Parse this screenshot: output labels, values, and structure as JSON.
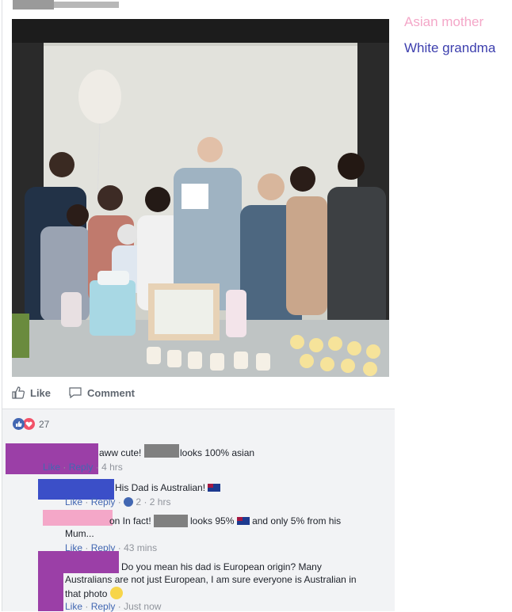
{
  "legend": {
    "asian_mother": "Asian mother",
    "white_grandma": "White grandma",
    "colors": {
      "asian_mother": "#f4a7c8",
      "white_grandma": "#3d3fae"
    }
  },
  "post": {
    "actions": {
      "like": "Like",
      "comment": "Comment"
    },
    "reactions": {
      "count": "27"
    }
  },
  "comments": [
    {
      "text_a": "aww cute!",
      "text_b": "looks 100% asian",
      "like": "Like",
      "reply": "Reply",
      "time": "4 hrs"
    },
    {
      "text": "His Dad is Australian!",
      "like": "Like",
      "reply": "Reply",
      "likes": "2",
      "time": "2 hrs"
    },
    {
      "text_a": "on In fact!",
      "text_b": "looks 95%",
      "text_c": "and only 5% from his",
      "text_d": "Mum...",
      "like": "Like",
      "reply": "Reply",
      "time": "43 mins"
    },
    {
      "text_a": "Do you mean his dad is European origin? Many",
      "text_b": "Australians are not just European, I am sure everyone is Australian in",
      "text_c": "that photo",
      "like": "Like",
      "reply": "Reply",
      "time": "Just now"
    }
  ],
  "colors": {
    "purple": "#9b3fa7",
    "blue": "#3b4fc8",
    "pink": "#f4a7c8",
    "link": "#4267b2"
  }
}
